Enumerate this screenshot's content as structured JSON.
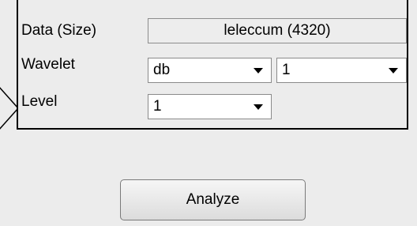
{
  "labels": {
    "data_size": "Data  (Size)",
    "wavelet": "Wavelet",
    "level": "Level"
  },
  "data_value": "leleccum  (4320)",
  "wavelet_family": {
    "selected": "db"
  },
  "wavelet_order": {
    "selected": "1"
  },
  "level": {
    "selected": "1"
  },
  "analyze_button": {
    "label": "Analyze"
  }
}
